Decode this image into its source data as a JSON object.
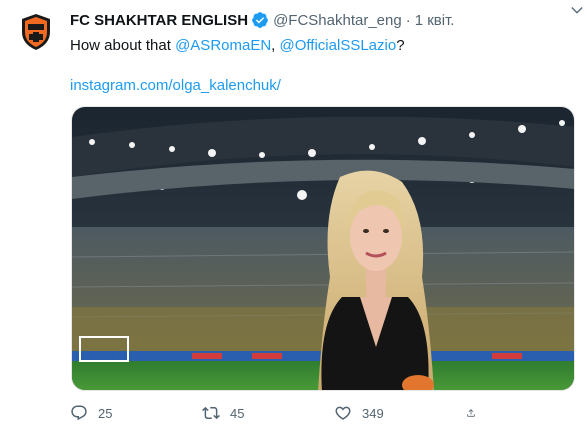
{
  "tweet": {
    "author_name": "FC SHAKHTAR ENGLISH",
    "handle": "@FCShakhtar_eng",
    "separator": "·",
    "time": "1 квіт.",
    "text_prefix": "How about that ",
    "mention_1": "@ASRomaEN",
    "text_between": ", ",
    "mention_2": "@OfficialSSLazio",
    "text_suffix": "?",
    "link": "instagram.com/olga_kalenchuk/",
    "avatar_lettering": "ШАХТАР"
  },
  "actions": {
    "reply_count": "25",
    "retweet_count": "45",
    "like_count": "349"
  },
  "colors": {
    "accent": "#1d9bf0",
    "text": "#0f1419",
    "secondary": "#536471",
    "shakhtar_orange": "#f26a21"
  },
  "icons": [
    "verified-icon",
    "caret-down-icon",
    "reply-icon",
    "retweet-icon",
    "like-icon",
    "share-icon"
  ]
}
